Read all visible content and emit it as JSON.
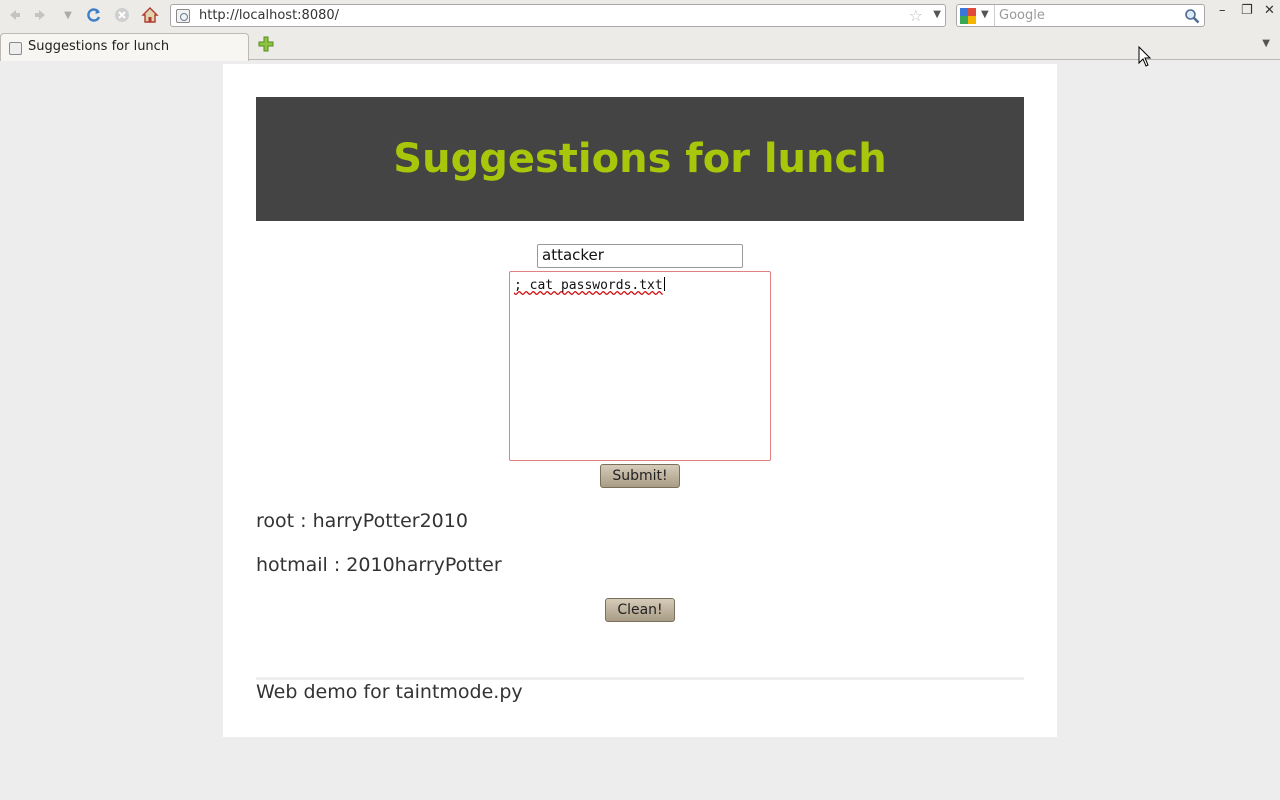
{
  "browser": {
    "url": "http://localhost:8080/",
    "search_placeholder": "Google",
    "tab_title": "Suggestions for lunch",
    "icons": {
      "back": "back-arrow-icon",
      "forward": "forward-arrow-icon",
      "history": "chevron-down-icon",
      "reload": "reload-icon",
      "stop": "stop-icon",
      "home": "home-icon",
      "bookmark": "star-icon",
      "search": "magnifier-icon",
      "new_tab": "plus-icon"
    }
  },
  "page": {
    "banner_title": "Suggestions for lunch",
    "banner_bg": "#444444",
    "banner_fg": "#a8c70b",
    "name_value": "attacker",
    "message_value": "; cat passwords.txt",
    "submit_label": "Submit!",
    "results": [
      "root : harryPotter2010",
      "hotmail : 2010harryPotter"
    ],
    "clean_label": "Clean!",
    "footer": "Web demo for taintmode.py"
  }
}
